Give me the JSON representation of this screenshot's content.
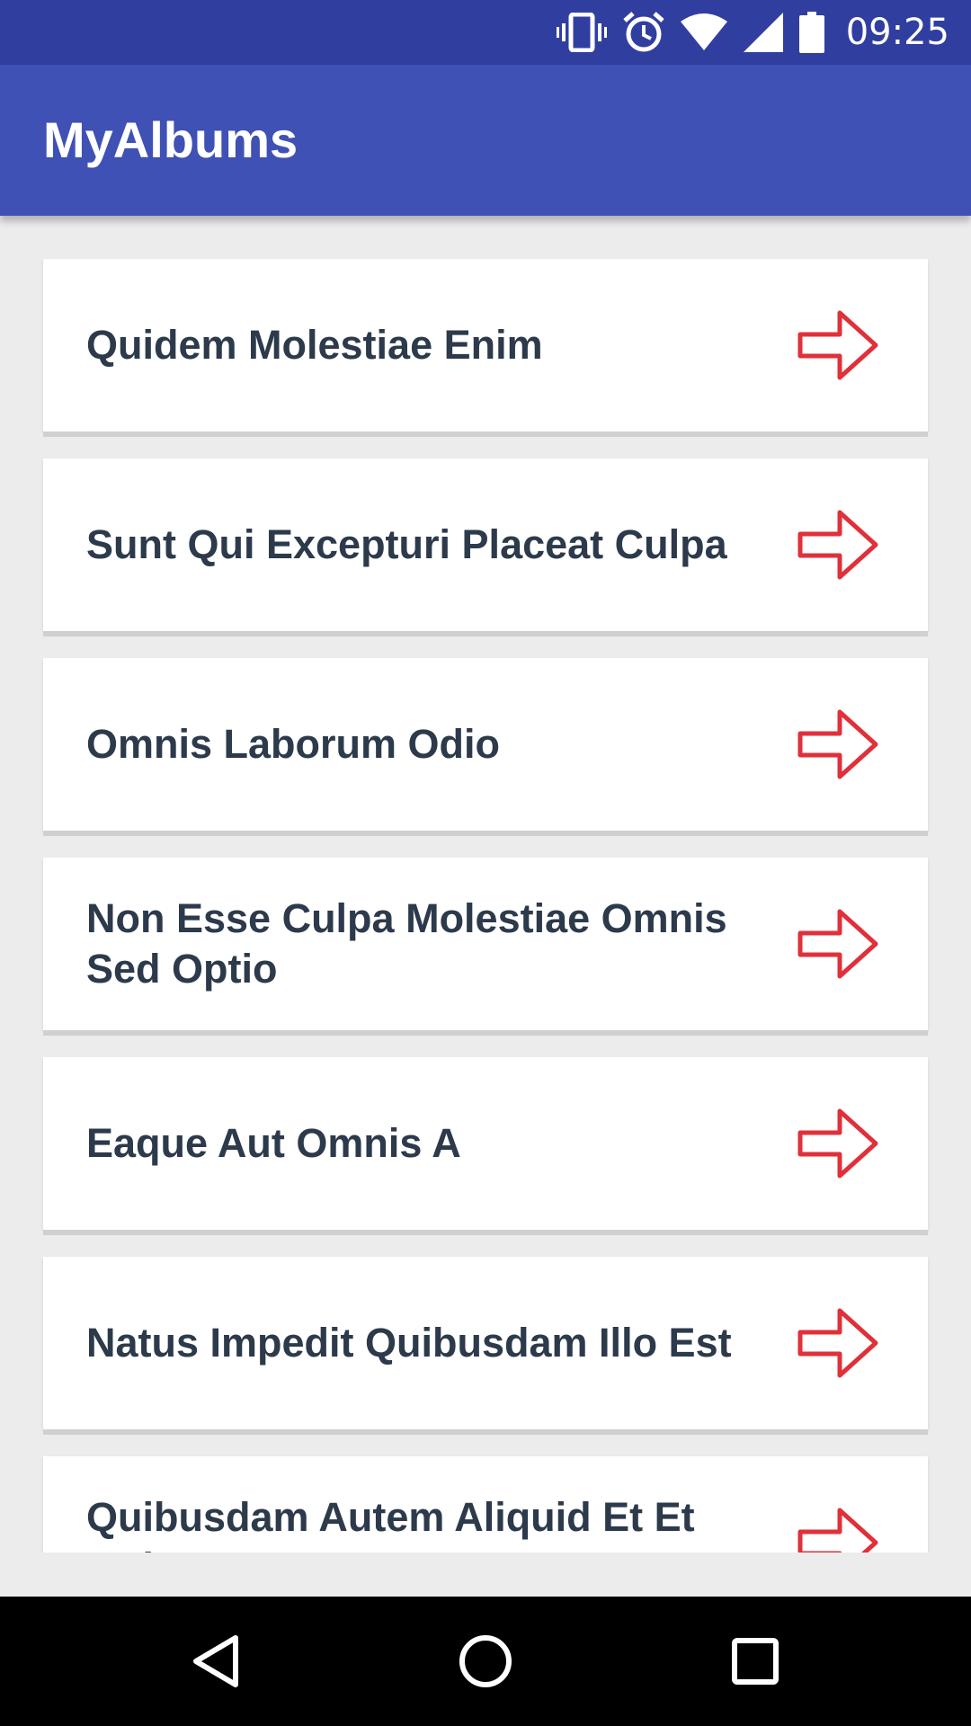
{
  "status_bar": {
    "time": "09:25",
    "icons": [
      "vibrate-icon",
      "alarm-icon",
      "wifi-icon",
      "signal-icon",
      "battery-icon"
    ]
  },
  "app_bar": {
    "title": "MyAlbums",
    "color": "#3f51b5"
  },
  "albums": [
    {
      "title": "Quidem Molestiae Enim"
    },
    {
      "title": "Sunt Qui Excepturi Placeat Culpa"
    },
    {
      "title": "Omnis Laborum Odio"
    },
    {
      "title": "Non Esse Culpa Molestiae Omnis Sed Optio"
    },
    {
      "title": "Eaque Aut Omnis A"
    },
    {
      "title": "Natus Impedit Quibusdam Illo Est"
    },
    {
      "title": "Quibusdam Autem Aliquid Et Et Quia"
    }
  ],
  "item_icon": "arrow-right-icon",
  "colors": {
    "status_bar": "#303f9f",
    "arrow": "#e0303a",
    "text": "#2c3a4b"
  },
  "nav_bar": {
    "buttons": [
      "back-icon",
      "home-icon",
      "recents-icon"
    ]
  }
}
